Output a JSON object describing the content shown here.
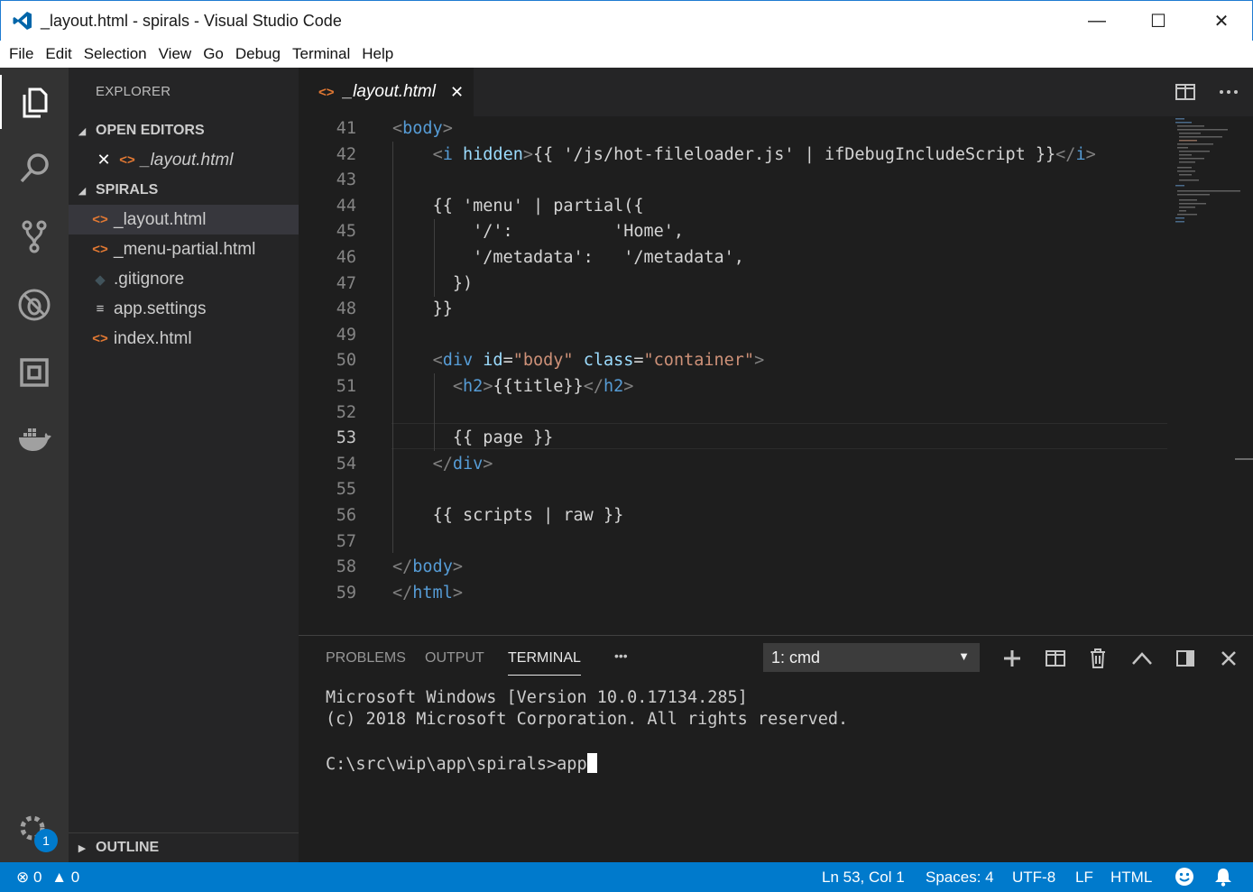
{
  "window": {
    "title": "_layout.html - spirals - Visual Studio Code",
    "minimize": "—",
    "maximize": "☐",
    "close": "✕"
  },
  "menu": [
    "File",
    "Edit",
    "Selection",
    "View",
    "Go",
    "Debug",
    "Terminal",
    "Help"
  ],
  "activity_bar": {
    "icons": [
      "explorer-icon",
      "search-icon",
      "source-control-icon",
      "debug-icon",
      "extensions-icon",
      "docker-icon",
      "settings-gear-icon"
    ],
    "badge": "1"
  },
  "sidebar": {
    "title": "EXPLORER",
    "open_editors_label": "OPEN EDITORS",
    "open_editors": [
      {
        "name": "_layout.html",
        "icon": "html-file-icon"
      }
    ],
    "folder_label": "SPIRALS",
    "files": [
      {
        "name": "_layout.html",
        "icon": "html-file-icon",
        "selected": true
      },
      {
        "name": "_menu-partial.html",
        "icon": "html-file-icon",
        "selected": false
      },
      {
        "name": ".gitignore",
        "icon": "git-file-icon",
        "selected": false
      },
      {
        "name": "app.settings",
        "icon": "settings-file-icon",
        "selected": false
      },
      {
        "name": "index.html",
        "icon": "html-file-icon",
        "selected": false
      }
    ],
    "outline_label": "OUTLINE"
  },
  "tab": {
    "label": "_layout.html",
    "close": "✕"
  },
  "editor": {
    "active_line": 53,
    "lines": [
      {
        "n": "41",
        "indent": 0,
        "tokens": [
          [
            "br",
            "<"
          ],
          [
            "tag",
            "body"
          ],
          [
            "br",
            ">"
          ]
        ]
      },
      {
        "n": "42",
        "indent": 2,
        "tokens": [
          [
            "br",
            "<"
          ],
          [
            "tag",
            "i"
          ],
          [
            "txt",
            " "
          ],
          [
            "attr",
            "hidden"
          ],
          [
            "br",
            ">"
          ],
          [
            "txt",
            "{{ '/js/hot-fileloader.js' | ifDebugIncludeScript }}"
          ],
          [
            "br",
            "</"
          ],
          [
            "tag",
            "i"
          ],
          [
            "br",
            ">"
          ]
        ]
      },
      {
        "n": "43",
        "indent": 0,
        "tokens": []
      },
      {
        "n": "44",
        "indent": 2,
        "tokens": [
          [
            "txt",
            "{{ 'menu' | partial({"
          ]
        ]
      },
      {
        "n": "45",
        "indent": 2,
        "tokens": [
          [
            "txt",
            "    '/':          'Home',"
          ]
        ]
      },
      {
        "n": "46",
        "indent": 2,
        "tokens": [
          [
            "txt",
            "    '/metadata':   '/metadata',"
          ]
        ]
      },
      {
        "n": "47",
        "indent": 2,
        "tokens": [
          [
            "txt",
            "  })"
          ]
        ]
      },
      {
        "n": "48",
        "indent": 2,
        "tokens": [
          [
            "txt",
            "}}"
          ]
        ]
      },
      {
        "n": "49",
        "indent": 0,
        "tokens": []
      },
      {
        "n": "50",
        "indent": 2,
        "tokens": [
          [
            "br",
            "<"
          ],
          [
            "tag",
            "div"
          ],
          [
            "txt",
            " "
          ],
          [
            "attr",
            "id"
          ],
          [
            "txt",
            "="
          ],
          [
            "str",
            "\"body\""
          ],
          [
            "txt",
            " "
          ],
          [
            "attr",
            "class"
          ],
          [
            "txt",
            "="
          ],
          [
            "str",
            "\"container\""
          ],
          [
            "br",
            ">"
          ]
        ]
      },
      {
        "n": "51",
        "indent": 3,
        "tokens": [
          [
            "br",
            "<"
          ],
          [
            "tag",
            "h2"
          ],
          [
            "br",
            ">"
          ],
          [
            "txt",
            "{{title}}"
          ],
          [
            "br",
            "</"
          ],
          [
            "tag",
            "h2"
          ],
          [
            "br",
            ">"
          ]
        ]
      },
      {
        "n": "52",
        "indent": 0,
        "tokens": []
      },
      {
        "n": "53",
        "indent": 3,
        "tokens": [
          [
            "txt",
            "{{ page }}"
          ]
        ]
      },
      {
        "n": "54",
        "indent": 2,
        "tokens": [
          [
            "br",
            "</"
          ],
          [
            "tag",
            "div"
          ],
          [
            "br",
            ">"
          ]
        ]
      },
      {
        "n": "55",
        "indent": 0,
        "tokens": []
      },
      {
        "n": "56",
        "indent": 2,
        "tokens": [
          [
            "txt",
            "{{ scripts | raw }}"
          ]
        ]
      },
      {
        "n": "57",
        "indent": 0,
        "tokens": []
      },
      {
        "n": "58",
        "indent": 0,
        "tokens": [
          [
            "br",
            "</"
          ],
          [
            "tag",
            "body"
          ],
          [
            "br",
            ">"
          ]
        ]
      },
      {
        "n": "59",
        "indent": 0,
        "tokens": [
          [
            "br",
            "</"
          ],
          [
            "tag",
            "html"
          ],
          [
            "br",
            ">"
          ]
        ]
      }
    ]
  },
  "panel": {
    "tabs": [
      "PROBLEMS",
      "OUTPUT",
      "TERMINAL"
    ],
    "active_tab": "TERMINAL",
    "more": "•••",
    "terminal_select": "1: cmd",
    "terminal_lines": [
      "Microsoft Windows [Version 10.0.17134.285]",
      "(c) 2018 Microsoft Corporation. All rights reserved.",
      "",
      "C:\\src\\wip\\app\\spirals>app"
    ]
  },
  "statusbar": {
    "errors": "0",
    "warnings": "0",
    "position": "Ln 53, Col 1",
    "spaces": "Spaces: 4",
    "encoding": "UTF-8",
    "eol": "LF",
    "language": "HTML"
  },
  "colors": {
    "accent": "#007acc",
    "activity_bar": "#333333",
    "sidebar": "#252526",
    "editor_bg": "#1e1e1e",
    "tag": "#569cd6",
    "attribute": "#9cdcfe",
    "string": "#ce9178",
    "html_icon": "#e37933"
  }
}
